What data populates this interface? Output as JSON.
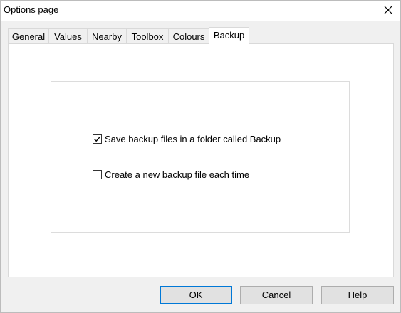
{
  "window": {
    "title": "Options page"
  },
  "tabs": [
    {
      "label": "General",
      "active": false
    },
    {
      "label": "Values",
      "active": false
    },
    {
      "label": "Nearby",
      "active": false
    },
    {
      "label": "Toolbox",
      "active": false
    },
    {
      "label": "Colours",
      "active": false
    },
    {
      "label": "Backup",
      "active": true
    }
  ],
  "backup": {
    "options": [
      {
        "label": "Save backup files in a folder called Backup",
        "checked": true
      },
      {
        "label": "Create a new backup file each time",
        "checked": false
      }
    ]
  },
  "buttons": {
    "ok": "OK",
    "cancel": "Cancel",
    "help": "Help"
  },
  "colors": {
    "accent": "#0078d7",
    "window_bg": "#f0f0f0",
    "panel_bg": "#ffffff"
  },
  "icons": {
    "close": "close-icon",
    "check": "check-icon"
  }
}
